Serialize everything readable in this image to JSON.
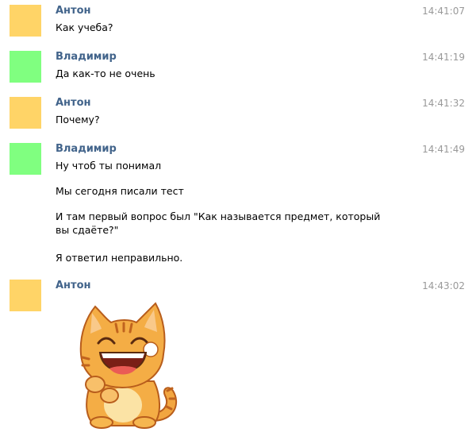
{
  "colors": {
    "anton_avatar": "#ffd467",
    "vladimir_avatar": "#80ff80",
    "name": "#42648b",
    "time": "#999999"
  },
  "messages": [
    {
      "author": "Антон",
      "time": "14:41:07",
      "lines": [
        "Как учеба?"
      ]
    },
    {
      "author": "Владимир",
      "time": "14:41:19",
      "lines": [
        "Да как-то не очень"
      ]
    },
    {
      "author": "Антон",
      "time": "14:41:32",
      "lines": [
        "Почему?"
      ]
    },
    {
      "author": "Владимир",
      "time": "14:41:49",
      "lines": [
        "Ну чтоб ты понимал",
        "Мы сегодня писали тест",
        "И там первый вопрос был \"Как называется предмет, который вы сдаёте?\"",
        "Я ответил неправильно."
      ]
    },
    {
      "author": "Антон",
      "time": "14:43:02",
      "sticker": "laughing-cat-sticker"
    }
  ]
}
